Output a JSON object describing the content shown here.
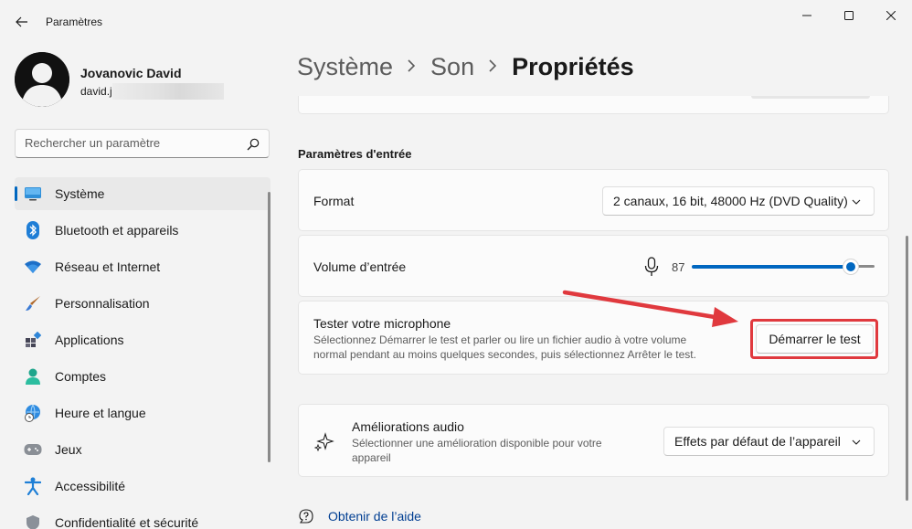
{
  "window": {
    "title": "Paramètres",
    "back_icon": "back-arrow-icon",
    "controls": [
      "minimize-icon",
      "maximize-icon",
      "close-icon"
    ]
  },
  "profile": {
    "name": "Jovanovic David",
    "email_visible": "david.j"
  },
  "search": {
    "placeholder": "Rechercher un paramètre",
    "icon": "search-icon"
  },
  "sidebar": {
    "items": [
      {
        "label": "Système",
        "icon": "monitor-icon",
        "selected": true
      },
      {
        "label": "Bluetooth et appareils",
        "icon": "bluetooth-icon"
      },
      {
        "label": "Réseau et Internet",
        "icon": "wifi-icon"
      },
      {
        "label": "Personnalisation",
        "icon": "paintbrush-icon"
      },
      {
        "label": "Applications",
        "icon": "apps-icon"
      },
      {
        "label": "Comptes",
        "icon": "person-icon"
      },
      {
        "label": "Heure et langue",
        "icon": "globe-clock-icon"
      },
      {
        "label": "Jeux",
        "icon": "gamepad-icon"
      },
      {
        "label": "Accessibilité",
        "icon": "accessibility-icon"
      },
      {
        "label": "Confidentialité et sécurité",
        "icon": "shield-icon"
      }
    ]
  },
  "breadcrumb": {
    "items": [
      "Système",
      "Son"
    ],
    "current": "Propriétés",
    "separator_icon": "chevron-right-icon"
  },
  "input_settings": {
    "section_title": "Paramètres d'entrée",
    "format": {
      "label": "Format",
      "selected": "2 canaux, 16 bit, 48000 Hz (DVD Quality)"
    },
    "volume": {
      "label": "Volume d’entrée",
      "icon": "microphone-icon",
      "value": "87",
      "level_percent": 87
    },
    "mic_test": {
      "title": "Tester votre microphone",
      "description_line1": "Sélectionnez Démarrer le test et parler ou lire un fichier audio à votre volume",
      "description_line2": "normal pendant au moins quelques secondes, puis sélectionnez Arrêter le test.",
      "button_label": "Démarrer le test"
    }
  },
  "audio_enhancements": {
    "icon": "sparkle-icon",
    "title": "Améliorations audio",
    "description_line1": "Sélectionner une amélioration disponible pour votre",
    "description_line2": "appareil",
    "selected": "Effets par défaut de l’appareil"
  },
  "help": {
    "icon": "help-icon",
    "label": "Obtenir de l’aide"
  },
  "colors": {
    "accent": "#0067c0",
    "annotation_red": "#e0393e"
  }
}
